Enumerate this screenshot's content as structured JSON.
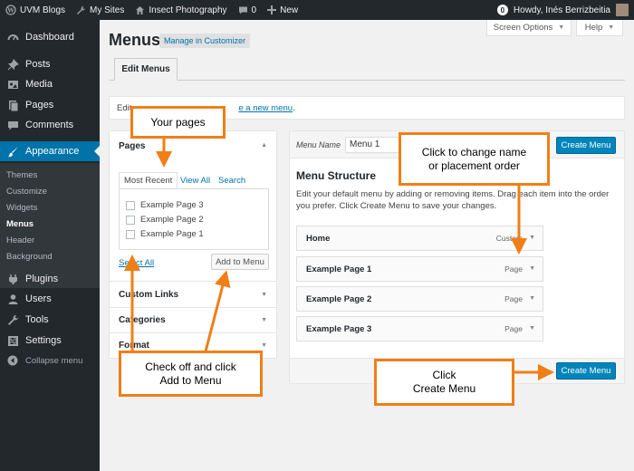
{
  "admin_bar": {
    "site_name": "UVM Blogs",
    "my_sites": "My Sites",
    "site_title": "Insect Photography",
    "comment_count": "0",
    "new_label": "New",
    "notification_count": "0",
    "greeting": "Howdy, Inés Berrizbeitia"
  },
  "sidebar": {
    "items": [
      {
        "label": "Dashboard",
        "icon": "dashboard-icon"
      },
      {
        "label": "Posts",
        "icon": "pin-icon"
      },
      {
        "label": "Media",
        "icon": "media-icon"
      },
      {
        "label": "Pages",
        "icon": "page-icon"
      },
      {
        "label": "Comments",
        "icon": "comment-icon"
      },
      {
        "label": "Appearance",
        "icon": "brush-icon"
      },
      {
        "label": "Plugins",
        "icon": "plugin-icon"
      },
      {
        "label": "Users",
        "icon": "user-icon"
      },
      {
        "label": "Tools",
        "icon": "wrench-icon"
      },
      {
        "label": "Settings",
        "icon": "settings-icon"
      },
      {
        "label": "Collapse menu",
        "icon": "collapse-icon"
      }
    ],
    "submenu": [
      "Themes",
      "Customize",
      "Widgets",
      "Menus",
      "Header",
      "Background"
    ],
    "colors": {
      "bg": "#23282d",
      "active": "#0073aa",
      "submenu_bg": "#32373c"
    }
  },
  "header": {
    "title": "Menus",
    "manage_link": "Manage in Customizer",
    "screen_options": "Screen Options",
    "help": "Help",
    "tab": "Edit Menus"
  },
  "info": {
    "text_prefix": "Edit",
    "link_text": "e a new menu",
    "suffix": "."
  },
  "pages_panel": {
    "title": "Pages",
    "tabs": [
      "Most Recent",
      "View All",
      "Search"
    ],
    "pages": [
      "Example Page 3",
      "Example Page 2",
      "Example Page 1"
    ],
    "select_all": "Select All",
    "add_button": "Add to Menu",
    "sections": [
      "Custom Links",
      "Categories",
      "Format"
    ]
  },
  "menu_editor": {
    "name_label": "Menu Name",
    "name_value": "Menu 1",
    "create_button": "Create Menu",
    "structure_title": "Menu Structure",
    "structure_desc": "Edit your default menu by adding or removing items. Drag each item into the order you prefer. Click Create Menu to save your changes.",
    "items": [
      {
        "label": "Home",
        "type": "Custom"
      },
      {
        "label": "Example Page 1",
        "type": "Page"
      },
      {
        "label": "Example Page 2",
        "type": "Page"
      },
      {
        "label": "Example Page 3",
        "type": "Page"
      }
    ],
    "accent": "#0085ba"
  },
  "callouts": {
    "your_pages": "Your pages",
    "change_name": "Click to change name\nor placement order",
    "check_off": "Check off and click\nAdd to Menu",
    "click_create": "Click\nCreate Menu",
    "color": "#f07f16"
  }
}
